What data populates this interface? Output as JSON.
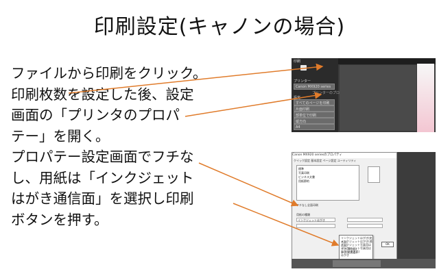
{
  "title": "印刷設定(キャノンの場合)",
  "instructions": "ファイルから印刷をクリック。\n印刷枚数を設定した後、設定\n画面の「プリンタのプロパ\nテー」を開く。\nプロパテー設定画面でフチな\nし、用紙は「インクジェット\nはがき通信面」を選択し印刷\nボタンを押す。",
  "arrow_color": "#e07b2a",
  "print_screen": {
    "header": "印刷",
    "printer_label": "プリンター",
    "printer_name": "Canon MX920 series",
    "printer_props": "プリンターのプロパティ",
    "settings_label": "設定",
    "btn1": "すべてのページを印刷",
    "btn2": "片面印刷",
    "btn3": "部単位で印刷",
    "btn4": "縦方向",
    "btn5": "A4",
    "btn6": "標準の余白"
  },
  "properties_dialog": {
    "title": "Canon MX920 seriesのプロパティ",
    "tabs": "クイック設定 基本設定 ページ設定 ユーティリティ",
    "list_items": [
      "標準",
      "写真印刷",
      "ビジネス文書",
      "用紙節約"
    ],
    "borderless_label": "フチなし全面印刷",
    "paper_label": "用紙の種類",
    "paper_value": "インクジェットはがき",
    "dropdown_items": [
      "インクジェットはがき(宛名面)",
      "インクジェットはがき(通信面)",
      "インクジェット写真用はがき(通信面)",
      "インクジェット写真用はがき(宛名面)",
      "はがき(宛名面)",
      "はがき"
    ],
    "ok_label": "OK"
  }
}
